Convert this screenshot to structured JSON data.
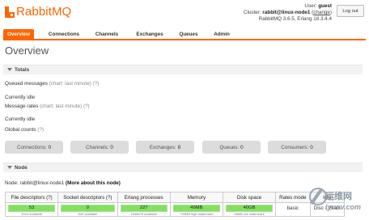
{
  "header": {
    "logo_text": "RabbitMQ",
    "user_label": "User:",
    "user_name": "guest",
    "cluster_label": "Cluster:",
    "cluster_name": "rabbit@linux-node1",
    "change_label": "change",
    "version": "RabbitMQ 3.6.5, Erlang 18.3.4.4",
    "logout_label": "Log out"
  },
  "tabs": [
    {
      "label": "Overview",
      "active": true
    },
    {
      "label": "Connections"
    },
    {
      "label": "Channels"
    },
    {
      "label": "Exchanges"
    },
    {
      "label": "Queues"
    },
    {
      "label": "Admin"
    }
  ],
  "page_title": "Overview",
  "totals": {
    "section_label": "Totals",
    "queued_messages_label": "Queued messages",
    "queued_messages_hint": "(chart: last minute) (?)",
    "queued_messages_status": "Currently idle",
    "message_rates_label": "Message rates",
    "message_rates_hint": "(chart: last minute) (?)",
    "message_rates_status": "Currently idle",
    "global_counts_label": "Global counts",
    "global_counts_hint": "(?)",
    "counts": [
      {
        "label": "Connections:",
        "value": "0"
      },
      {
        "label": "Channels:",
        "value": "0"
      },
      {
        "label": "Exchanges:",
        "value": "8"
      },
      {
        "label": "Queues:",
        "value": "0"
      },
      {
        "label": "Consumers:",
        "value": "0"
      }
    ]
  },
  "node": {
    "section_label": "Node",
    "node_prefix": "Node:",
    "node_name": "rabbit@linux-node1",
    "more_link": "(More about this node)",
    "columns": [
      "File descriptors (?)",
      "Socket descriptors (?)",
      "Erlang processes",
      "Memory",
      "Disk space",
      "Rates mode",
      "Info"
    ],
    "values": {
      "file_descriptors": "53",
      "file_descriptors_sub": "1024 available",
      "socket_descriptors": "0",
      "socket_descriptors_sub": "829 available",
      "erlang_processes": "227",
      "erlang_processes_sub": "1048576 available",
      "memory": "49MB",
      "memory_sub": "730MB high watermark",
      "disk_space": "40GB",
      "disk_space_sub": "48MB low watermark",
      "rates_mode": "basic",
      "info": "Disc 1 Stats"
    }
  },
  "watermark": {
    "text": "运维网",
    "url": "iyunv.com"
  }
}
